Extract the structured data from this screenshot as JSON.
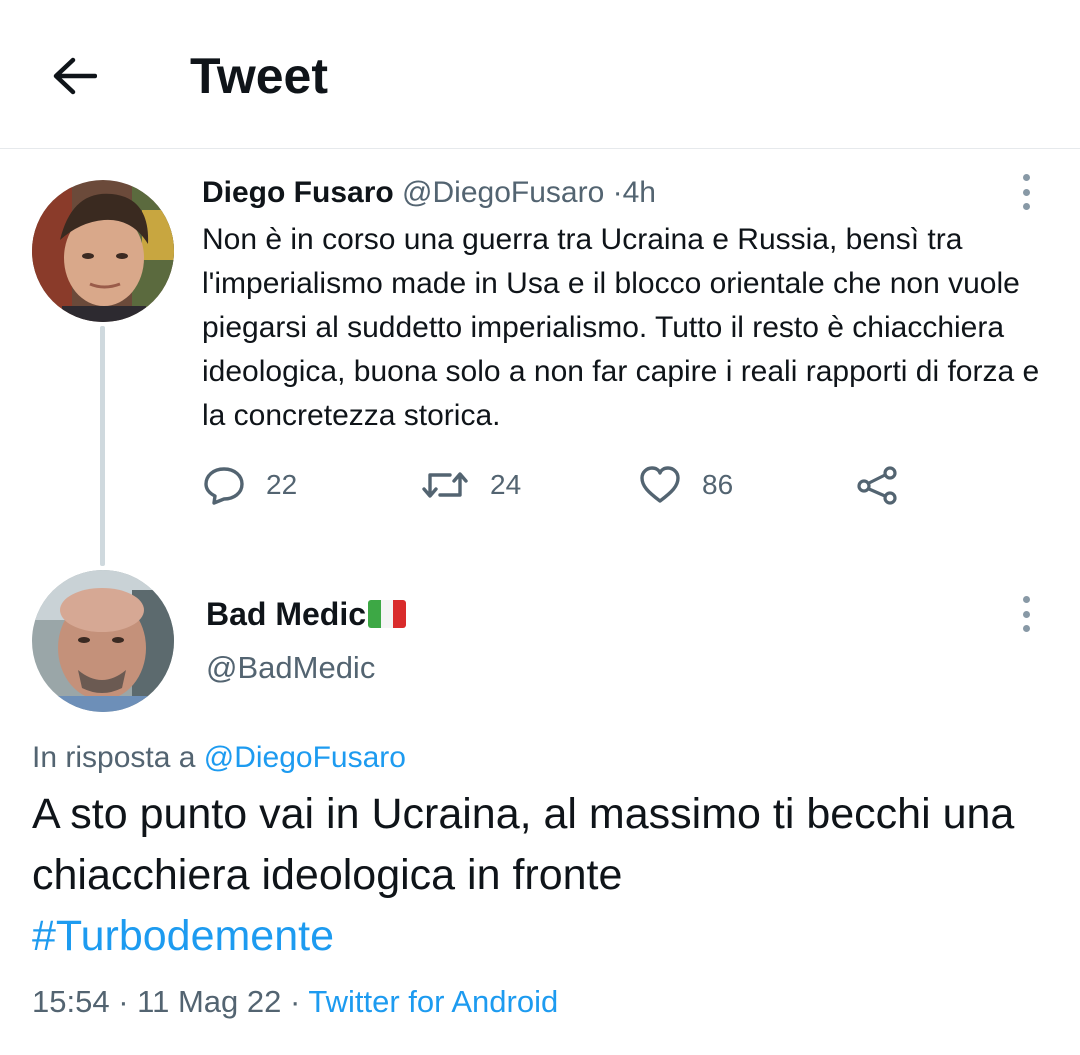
{
  "header": {
    "back_icon": "arrow-left-icon",
    "title": "Tweet"
  },
  "parent_tweet": {
    "author_name": "Diego Fusaro",
    "author_handle": "@DiegoFusaro",
    "separator": "·",
    "time": "4h",
    "text": "Non è in corso una guerra tra Ucraina e Russia, bensì tra l'imperialismo made in Usa e il blocco orientale che non vuole piegarsi al suddetto imperialismo. Tutto il resto è chiacchiera ideologica, buona solo a non far capire i reali rapporti di forza e la concretezza storica.",
    "replies": "22",
    "retweets": "24",
    "likes": "86",
    "icons": {
      "reply": "reply-bubble-icon",
      "retweet": "retweet-icon",
      "like": "heart-icon",
      "share": "share-icon",
      "more": "more-vertical-icon"
    }
  },
  "reply_tweet": {
    "author_name": "Bad Medic",
    "author_flag": "italy-flag-icon",
    "author_handle": "@BadMedic",
    "in_reply_prefix": "In risposta a",
    "in_reply_handle": "@DiegoFusaro",
    "text": "A sto punto vai in Ucraina, al massimo ti becchi una chiacchiera ideologica in fronte",
    "hashtag": "#Turbodemente",
    "time": "15:54",
    "separator": "·",
    "date": "11 Mag 22",
    "client": "Twitter for Android"
  },
  "colors": {
    "text": "#0f1419",
    "muted": "#536471",
    "link": "#1d9bf0",
    "divider": "#e6e9ec",
    "thread_line": "#cfd9de"
  }
}
